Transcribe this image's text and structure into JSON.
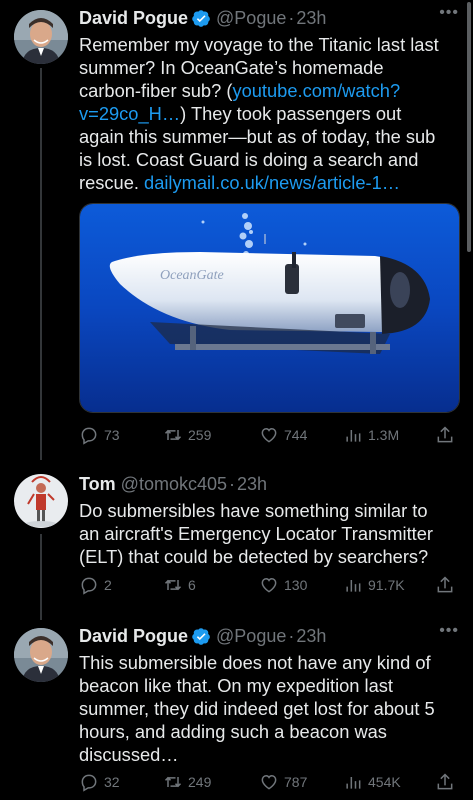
{
  "tweets": [
    {
      "name": "David Pogue",
      "handle": "@Pogue",
      "dot": "·",
      "time": "23h",
      "text_part1": "Remember my voyage to the Titanic last last summer? In OceanGate’s homemade carbon-fiber sub? (",
      "link1": "youtube.com/watch?v=29co_H…",
      "text_part2": ") They took passengers out again this summer—but as of today, the sub is lost. Coast Guard is doing a search and rescue. ",
      "link2": "dailymail.co.uk/news/article-1…",
      "media_caption": "OceanGate",
      "replies": "73",
      "retweets": "259",
      "likes": "744",
      "views": "1.3M"
    },
    {
      "name": "Tom",
      "handle": "@tomokc405",
      "dot": "·",
      "time": "23h",
      "text": "Do submersibles have something similar to an aircraft's Emergency Locator Transmitter (ELT) that could be detected by searchers?",
      "replies": "2",
      "retweets": "6",
      "likes": "130",
      "views": "91.7K"
    },
    {
      "name": "David Pogue",
      "handle": "@Pogue",
      "dot": "·",
      "time": "23h",
      "text": "This submersible does not have any kind of beacon like that. On my expedition last summer, they did indeed get lost for about 5 hours, and adding such a beacon was discussed…",
      "replies": "32",
      "retweets": "249",
      "likes": "787",
      "views": "454K"
    }
  ],
  "more_label": "•••",
  "colors": {
    "link": "#1d9bf0",
    "muted": "#71767b",
    "verified": "#1d9bf0"
  }
}
